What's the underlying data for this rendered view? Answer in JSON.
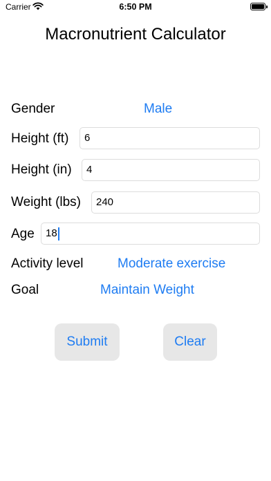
{
  "status_bar": {
    "carrier": "Carrier",
    "time": "6:50 PM"
  },
  "title": "Macronutrient Calculator",
  "form": {
    "gender": {
      "label": "Gender",
      "value": "Male"
    },
    "height_ft": {
      "label": "Height (ft)",
      "value": "6"
    },
    "height_in": {
      "label": "Height (in)",
      "value": "4"
    },
    "weight": {
      "label": "Weight (lbs)",
      "value": "240"
    },
    "age": {
      "label": "Age",
      "value": "18"
    },
    "activity": {
      "label": "Activity level",
      "value": "Moderate exercise"
    },
    "goal": {
      "label": "Goal",
      "value": "Maintain Weight"
    }
  },
  "buttons": {
    "submit": "Submit",
    "clear": "Clear"
  },
  "icons": {
    "wifi": "wifi-icon",
    "battery": "battery-icon"
  },
  "colors": {
    "accent": "#1e7cf2",
    "button_bg": "#e7e7e7"
  }
}
